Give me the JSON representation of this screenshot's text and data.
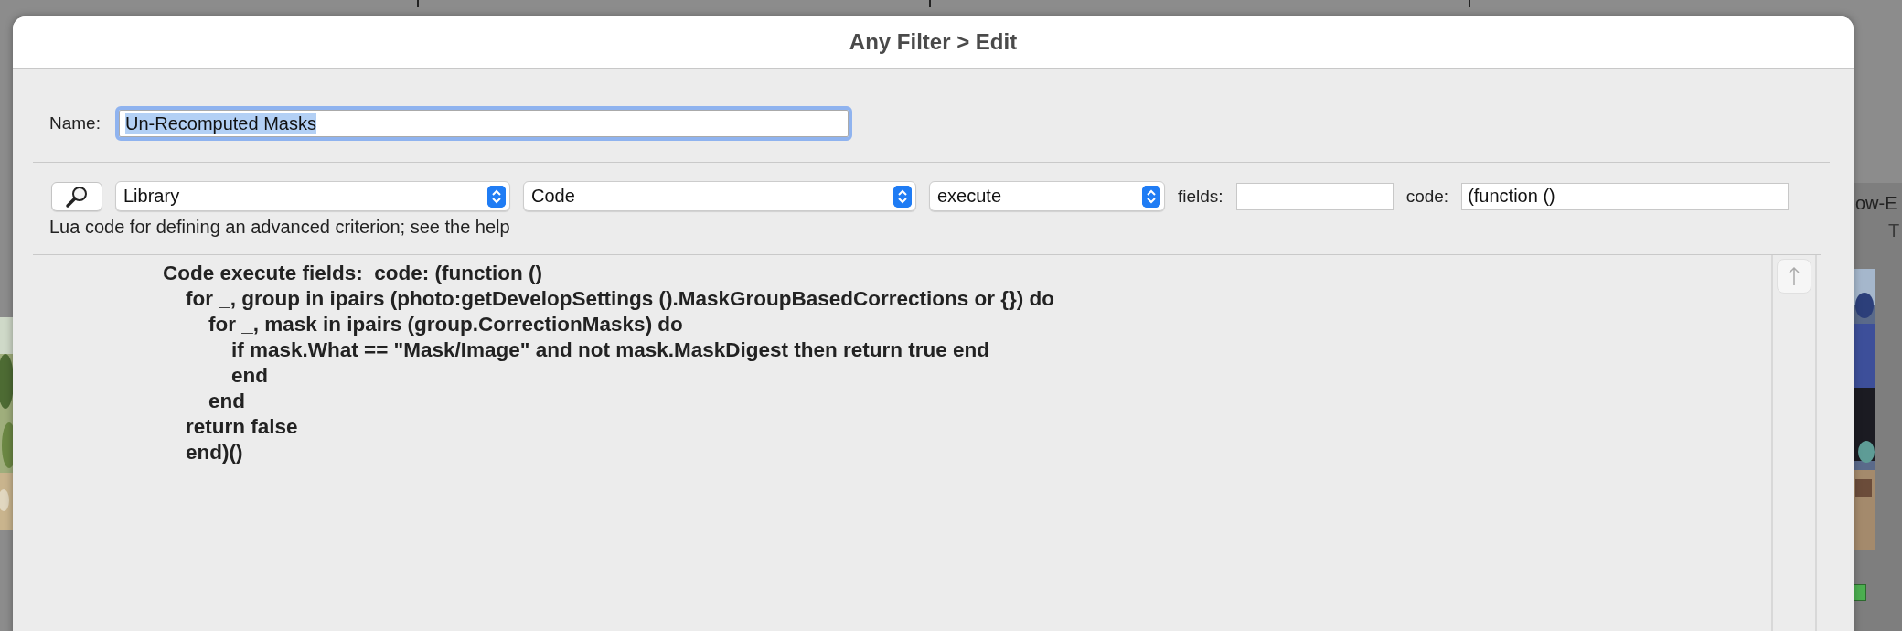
{
  "background": {
    "side_texts": [
      "ow-E",
      "T"
    ],
    "photos": [
      {
        "kind": "picture"
      },
      {
        "kind": "picture"
      }
    ]
  },
  "dialog": {
    "title": "Any Filter > Edit",
    "name": {
      "label": "Name:",
      "value": "Un-Recomputed Masks",
      "selected": true
    },
    "criteria": {
      "popups": [
        {
          "value": "Library"
        },
        {
          "value": "Code"
        },
        {
          "value": "execute"
        }
      ],
      "fields": {
        "label": "fields:"
      },
      "code": {
        "label": "code:",
        "value": "(function ()"
      },
      "help": "Lua code for defining an advanced criterion; see the help"
    },
    "code_lines": [
      "Code execute fields:  code: (function ()",
      "    for _, group in ipairs (photo:getDevelopSettings ().MaskGroupBasedCorrections or {}) do",
      "        for _, mask in ipairs (group.CorrectionMasks) do",
      "            if mask.What == \"Mask/Image\" and not mask.MaskDigest then return true end",
      "            end",
      "        end",
      "    return false",
      "    end)()"
    ]
  }
}
